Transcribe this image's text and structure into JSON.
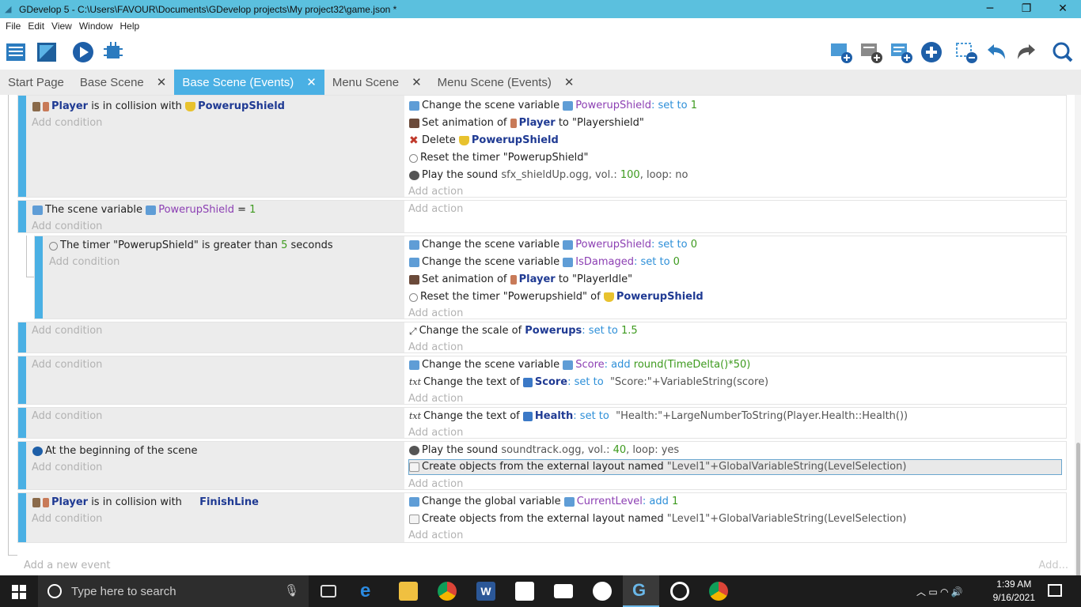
{
  "window": {
    "title": "GDevelop 5 - C:\\Users\\FAVOUR\\Documents\\GDevelop projects\\My project32\\game.json *",
    "minimize": "─",
    "restore": "❐",
    "close": "✕"
  },
  "menu": [
    "File",
    "Edit",
    "View",
    "Help",
    "Window"
  ],
  "menu_order": {
    "file": "File",
    "edit": "Edit",
    "view": "View",
    "window": "Window",
    "help": "Help"
  },
  "tabs": [
    {
      "label": "Start Page",
      "closable": false
    },
    {
      "label": "Base Scene",
      "closable": true
    },
    {
      "label": "Base Scene (Events)",
      "closable": true,
      "active": true
    },
    {
      "label": "Menu Scene",
      "closable": true
    },
    {
      "label": "Menu Scene (Events)",
      "closable": true
    }
  ],
  "tab_close": "✕",
  "events": {
    "e1": {
      "c1": {
        "obj": "Player",
        "t1": " is in collision with ",
        "obj2": "PowerupShield"
      },
      "add_condition": "Add condition",
      "a1": {
        "t": "Change the scene variable ",
        "v": "PowerupShield",
        "op": ": set to ",
        "n": "1"
      },
      "a2": {
        "t": "Set animation of ",
        "obj": "Player",
        "s": " to \"Playershield\""
      },
      "a3": {
        "t": "Delete ",
        "obj": "PowerupShield"
      },
      "a4": {
        "t": "Reset the timer \"PowerupShield\""
      },
      "a5": {
        "t": "Play the sound ",
        "s": "sfx_shieldUp.ogg, vol.: ",
        "n": "100",
        "s2": ", loop: no"
      },
      "add_action": "Add action"
    },
    "e2": {
      "c1": {
        "t": "The scene variable ",
        "v": "PowerupShield",
        "op": " = ",
        "n": "1"
      },
      "add_condition": "Add condition",
      "add_action": "Add action"
    },
    "e3": {
      "c1": {
        "t": "The timer \"PowerupShield\" is greater than ",
        "n": "5",
        "t2": " seconds"
      },
      "add_condition": "Add condition",
      "a1": {
        "t": "Change the scene variable ",
        "v": "PowerupShield",
        "op": ": set to ",
        "n": "0"
      },
      "a2": {
        "t": "Change the scene variable ",
        "v": "IsDamaged",
        "op": ": set to ",
        "n": "0"
      },
      "a3": {
        "t": "Set animation of ",
        "obj": "Player",
        "s": " to \"PlayerIdle\""
      },
      "a4": {
        "t": "Reset the timer \"Powerupshield\" of ",
        "obj": "PowerupShield"
      },
      "add_action": "Add action"
    },
    "e4": {
      "add_condition": "Add condition",
      "a1": {
        "t": "Change the scale of ",
        "obj": "Powerups",
        "op": ": set to ",
        "n": "1.5"
      },
      "add_action": "Add action"
    },
    "e5": {
      "add_condition": "Add condition",
      "a1": {
        "t": "Change the scene variable ",
        "v": "Score",
        "op": ": add ",
        "n": "round(TimeDelta()*50)"
      },
      "a2": {
        "t": "Change the text of ",
        "obj": "Score",
        "op": ": set to ",
        "s": " \"Score:\"+VariableString(score)"
      },
      "add_action": "Add action"
    },
    "e6": {
      "add_condition": "Add condition",
      "a1": {
        "t": "Change the text of ",
        "obj": "Health",
        "op": ": set to ",
        "s": " \"Health:\"+LargeNumberToString(Player.Health::Health())"
      },
      "add_action": "Add action"
    },
    "e7": {
      "c1": {
        "t": "At the beginning of the scene"
      },
      "add_condition": "Add condition",
      "a1": {
        "t": "Play the sound ",
        "s": "soundtrack.ogg, vol.: ",
        "n": "40",
        "s2": ", loop: yes"
      },
      "a2": {
        "t": "Create objects from the external layout named ",
        "s": "\"Level1\"+GlobalVariableString(LevelSelection)"
      },
      "add_action": "Add action"
    },
    "e8": {
      "c1": {
        "obj": "Player",
        "t1": " is in collision with ",
        "obj2": "FinishLine"
      },
      "add_condition": "Add condition",
      "a1": {
        "t": "Change the global variable ",
        "v": "CurrentLevel",
        "op": ": add ",
        "n": "1"
      },
      "a2": {
        "t": "Create objects from the external layout named ",
        "s": "\"Level1\"+GlobalVariableString(LevelSelection)"
      },
      "add_action": "Add action"
    }
  },
  "add_new_event": "Add a new event",
  "add_more": "Add...",
  "taskbar": {
    "search_placeholder": "Type here to search",
    "time": "1:39 AM",
    "date": "9/16/2021"
  },
  "colors": {
    "accent": "#4ab0e4",
    "titlebar": "#5bc0de",
    "object": "#1f3a93",
    "variable": "#8c3fb3",
    "keyword": "#2d8fd8",
    "number": "#3d9a1e"
  }
}
